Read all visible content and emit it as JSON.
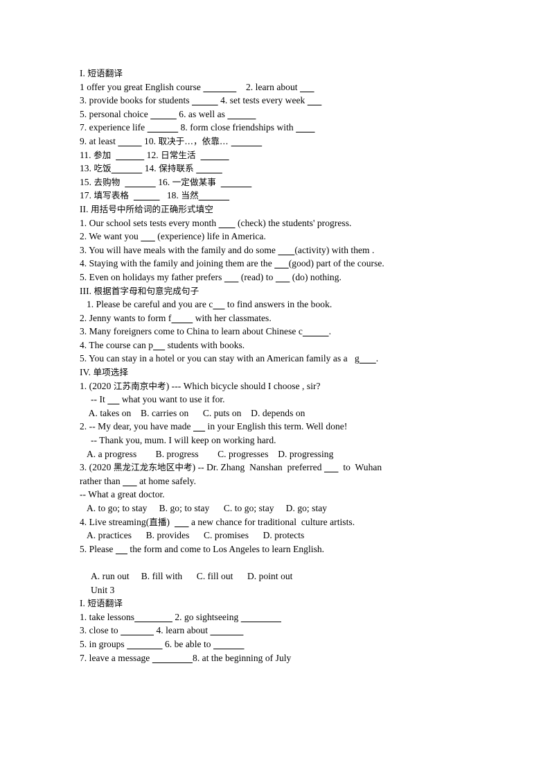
{
  "document": {
    "type": "english-exercise-worksheet",
    "sections": [
      {
        "id": "unit2-sec1",
        "heading": "I. 短语翻译",
        "heading_numeral": "I.",
        "heading_cn": "短语翻译",
        "lines": [
          {
            "id": "u2s1-l1",
            "indent": 0,
            "parts": [
              {
                "t": "1 offer you great English course "
              },
              {
                "u": "              "
              },
              {
                "t": "    2. learn about "
              },
              {
                "u": "      "
              }
            ]
          },
          {
            "id": "u2s1-l2",
            "indent": 0,
            "parts": [
              {
                "t": "3. provide books for students "
              },
              {
                "u": "           "
              },
              {
                "t": " 4. set tests every week "
              },
              {
                "u": "      "
              }
            ]
          },
          {
            "id": "u2s1-l3",
            "indent": 0,
            "parts": [
              {
                "t": "5. personal choice "
              },
              {
                "u": "           "
              },
              {
                "t": " 6. as well as "
              },
              {
                "u": "            "
              }
            ]
          },
          {
            "id": "u2s1-l4",
            "indent": 0,
            "parts": [
              {
                "t": "7. experience life "
              },
              {
                "u": "             "
              },
              {
                "t": " 8. form close friendships with "
              },
              {
                "u": "        "
              }
            ]
          },
          {
            "id": "u2s1-l5",
            "indent": 0,
            "parts": [
              {
                "t": "9. at least "
              },
              {
                "u": "          "
              },
              {
                "t": " 10. ",
                "cn": false
              },
              {
                "t": "取决于…，依靠… ",
                "cn": true
              },
              {
                "u": "             "
              }
            ]
          },
          {
            "id": "u2s1-l6",
            "indent": 0,
            "parts": [
              {
                "t": "11. "
              },
              {
                "t": "参加",
                "cn": true
              },
              {
                "t": "  "
              },
              {
                "u": "            "
              },
              {
                "t": " 12. "
              },
              {
                "t": "日常生活",
                "cn": true
              },
              {
                "t": "  "
              },
              {
                "u": "            "
              }
            ]
          },
          {
            "id": "u2s1-l7",
            "indent": 0,
            "parts": [
              {
                "t": "13. "
              },
              {
                "t": "吃饭",
                "cn": true
              },
              {
                "u": "             "
              },
              {
                "t": " 14. "
              },
              {
                "t": "保持联系",
                "cn": true
              },
              {
                "t": " "
              },
              {
                "u": "           "
              }
            ]
          },
          {
            "id": "u2s1-l8",
            "indent": 0,
            "parts": [
              {
                "t": "15. "
              },
              {
                "t": "去购物",
                "cn": true
              },
              {
                "t": "  "
              },
              {
                "u": "             "
              },
              {
                "t": " 16. "
              },
              {
                "t": "一定做某事",
                "cn": true
              },
              {
                "t": "  "
              },
              {
                "u": "             "
              }
            ]
          },
          {
            "id": "u2s1-l9",
            "indent": 0,
            "parts": [
              {
                "t": "17. "
              },
              {
                "t": "填写表格",
                "cn": true
              },
              {
                "t": "  "
              },
              {
                "u": "           "
              },
              {
                "t": "   18. "
              },
              {
                "t": "当然",
                "cn": true
              },
              {
                "u": "             "
              }
            ]
          }
        ]
      },
      {
        "id": "unit2-sec2",
        "heading": "II. 用括号中所给词的正确形式填空",
        "heading_numeral": "II.",
        "heading_cn": "用括号中所给词的正确形式填空",
        "lines": [
          {
            "id": "u2s2-l1",
            "indent": 0,
            "parts": [
              {
                "t": "1. Our school sets tests every month "
              },
              {
                "u": "       "
              },
              {
                "t": " (check) the students' progress."
              }
            ]
          },
          {
            "id": "u2s2-l2",
            "indent": 0,
            "parts": [
              {
                "t": "2. We want you "
              },
              {
                "u": "      "
              },
              {
                "t": " (experience) life in America."
              }
            ]
          },
          {
            "id": "u2s2-l3",
            "indent": 0,
            "parts": [
              {
                "t": "3. You will have meals with the family and do some "
              },
              {
                "u": "       "
              },
              {
                "t": "(activity) with them ."
              }
            ]
          },
          {
            "id": "u2s2-l4",
            "indent": 0,
            "parts": [
              {
                "t": "4. Staying with the family and joining them are the "
              },
              {
                "u": "      "
              },
              {
                "t": "(good) part of the course."
              }
            ]
          },
          {
            "id": "u2s2-l5",
            "indent": 0,
            "parts": [
              {
                "t": "5. Even on holidays my father prefers "
              },
              {
                "u": "      "
              },
              {
                "t": " (read) to "
              },
              {
                "u": "      "
              },
              {
                "t": " (do) nothing."
              }
            ]
          }
        ]
      },
      {
        "id": "unit2-sec3",
        "heading": "III. 根据首字母和句意完成句子",
        "heading_numeral": "III.",
        "heading_cn": "根据首字母和句意完成句子",
        "lines": [
          {
            "id": "u2s3-l1",
            "indent": 1,
            "parts": [
              {
                "t": "1. Please be careful and you are c"
              },
              {
                "u": "     "
              },
              {
                "t": " to find answers in the book."
              }
            ]
          },
          {
            "id": "u2s3-l2",
            "indent": 0,
            "parts": [
              {
                "t": "2. Jenny wants to form f"
              },
              {
                "u": "         "
              },
              {
                "t": " with her classmates."
              }
            ]
          },
          {
            "id": "u2s3-l3",
            "indent": 0,
            "parts": [
              {
                "t": "3. Many foreigners come to China to learn about Chinese c"
              },
              {
                "u": "           "
              },
              {
                "t": "."
              }
            ]
          },
          {
            "id": "u2s3-l4",
            "indent": 0,
            "parts": [
              {
                "t": "4. The course can p"
              },
              {
                "u": "     "
              },
              {
                "t": " students with books."
              }
            ]
          },
          {
            "id": "u2s3-l5",
            "indent": 0,
            "parts": [
              {
                "t": "5. You can stay in a hotel or you can stay with an American family as a   g"
              },
              {
                "u": "       "
              },
              {
                "t": "."
              }
            ]
          }
        ]
      },
      {
        "id": "unit2-sec4",
        "heading": "IV. 单项选择",
        "heading_numeral": "IV.",
        "heading_cn": "单项选择",
        "lines": [
          {
            "id": "u2s4-q1",
            "indent": 0,
            "parts": [
              {
                "t": "1. (2020 "
              },
              {
                "t": "江苏南京中考",
                "cn": true
              },
              {
                "t": ") --- Which bicycle should I choose , sir?"
              }
            ]
          },
          {
            "id": "u2s4-q1b",
            "indent": 2,
            "parts": [
              {
                "t": "-- It "
              },
              {
                "u": "     "
              },
              {
                "t": " what you want to use it for."
              }
            ]
          },
          {
            "id": "u2s4-q1o",
            "indent": 1,
            "parts": [
              {
                "t": " A. takes on    B. carries on      C. puts on    D. depends on"
              }
            ]
          },
          {
            "id": "u2s4-q2",
            "indent": 0,
            "parts": [
              {
                "t": "2. -- My dear, you have made "
              },
              {
                "u": "     "
              },
              {
                "t": " in your English this term. Well done!"
              }
            ]
          },
          {
            "id": "u2s4-q2b",
            "indent": 2,
            "parts": [
              {
                "t": "-- Thank you, mum. I will keep on working hard."
              }
            ]
          },
          {
            "id": "u2s4-q2o",
            "indent": 1,
            "parts": [
              {
                "t": "A. a progress        B. progress        C. progresses    D. progressing"
              }
            ]
          },
          {
            "id": "u2s4-q3",
            "indent": 0,
            "parts": [
              {
                "t": "3. (2020 "
              },
              {
                "t": "黑龙江龙东地区中考",
                "cn": true
              },
              {
                "t": ") -- Dr. Zhang  Nanshan  preferred "
              },
              {
                "u": "      "
              },
              {
                "t": "  to  Wuhan"
              }
            ]
          },
          {
            "id": "u2s4-q3b",
            "indent": 0,
            "parts": [
              {
                "t": "rather than "
              },
              {
                "u": "      "
              },
              {
                "t": " at home safely."
              }
            ]
          },
          {
            "id": "u2s4-q3c",
            "indent": 0,
            "parts": [
              {
                "t": "-- What a great doctor."
              }
            ]
          },
          {
            "id": "u2s4-q3o",
            "indent": 1,
            "parts": [
              {
                "t": "A. to go; to stay     B. go; to stay      C. to go; stay     D. go; stay"
              }
            ]
          },
          {
            "id": "u2s4-q4",
            "indent": 0,
            "parts": [
              {
                "t": "4. Live streaming("
              },
              {
                "t": "直播",
                "cn": true
              },
              {
                "t": ")  "
              },
              {
                "u": "      "
              },
              {
                "t": " a new chance for traditional  culture artists."
              }
            ]
          },
          {
            "id": "u2s4-q4o",
            "indent": 1,
            "parts": [
              {
                "t": "A. practices      B. provides      C. promises      D. protects"
              }
            ]
          },
          {
            "id": "u2s4-q5",
            "indent": 0,
            "parts": [
              {
                "t": "5. Please "
              },
              {
                "u": "     "
              },
              {
                "t": " the form and come to Los Angeles to learn English."
              }
            ]
          },
          {
            "id": "u2s4-blank",
            "indent": 0,
            "parts": [
              {
                "t": " "
              }
            ]
          },
          {
            "id": "u2s4-q5o",
            "indent": 2,
            "parts": [
              {
                "t": "A. run out     B. fill with      C. fill out      D. point out"
              }
            ]
          }
        ]
      },
      {
        "id": "unit3-title",
        "heading": "",
        "heading_numeral": "",
        "heading_cn": "",
        "title_line": "Unit 3",
        "lines": []
      },
      {
        "id": "unit3-sec1",
        "heading": "I. 短语翻译",
        "heading_numeral": "I.",
        "heading_cn": "短语翻译",
        "lines": [
          {
            "id": "u3s1-l1",
            "indent": 0,
            "parts": [
              {
                "t": "1. take lessons"
              },
              {
                "u": "                "
              },
              {
                "t": " 2. go sightseeing "
              },
              {
                "u": "                 "
              }
            ]
          },
          {
            "id": "u3s1-l2",
            "indent": 0,
            "parts": [
              {
                "t": "3. close to "
              },
              {
                "u": "              "
              },
              {
                "t": " 4. learn about "
              },
              {
                "u": "              "
              }
            ]
          },
          {
            "id": "u3s1-l3",
            "indent": 0,
            "parts": [
              {
                "t": "5. in groups "
              },
              {
                "u": "               "
              },
              {
                "t": " 6. be able to "
              },
              {
                "u": "             "
              }
            ]
          },
          {
            "id": "u3s1-l4",
            "indent": 0,
            "parts": [
              {
                "t": "7. leave a message "
              },
              {
                "u": "                 "
              },
              {
                "t": "8. at the beginning of July"
              }
            ]
          }
        ]
      }
    ]
  }
}
